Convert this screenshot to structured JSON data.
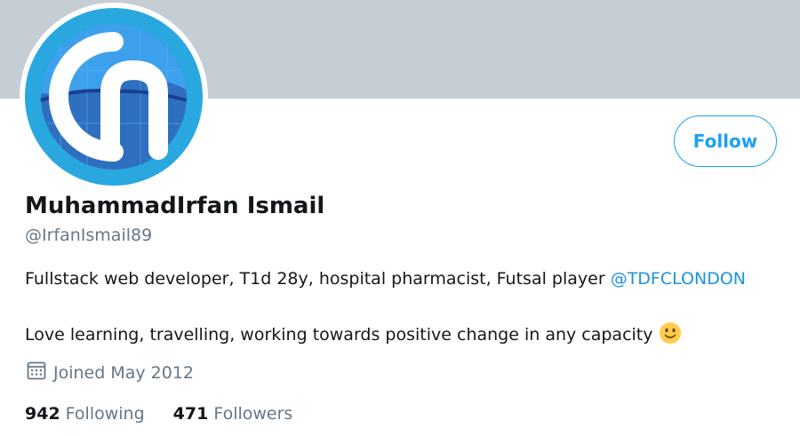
{
  "profile": {
    "display_name": "MuhammadIrfan Ismail",
    "handle": "@IrfanIsmail89",
    "follow_label": "Follow",
    "bio_line1_text": "Fullstack web developer, T1d 28y, hospital pharmacist, Futsal player ",
    "bio_mention": "@TDFCLONDON",
    "bio_line2_text": "Love learning, travelling, working towards positive change in any capacity",
    "bio_emoji": "slightly-smiling-face",
    "joined": "Joined May 2012",
    "following_count": "942",
    "following_label": "Following",
    "followers_count": "471",
    "followers_label": "Followers"
  },
  "colors": {
    "banner": "#c5ced4",
    "accent": "#1da1f2",
    "mention": "#1b95e0",
    "secondary_text": "#657786",
    "primary_text": "#14171a",
    "avatar_ring": "#29a8e0",
    "avatar_background": "#2f6fc0"
  },
  "icons": {
    "calendar": "calendar-icon",
    "emoji": "smiley-emoji-icon",
    "avatar_logo": "ci-logo"
  }
}
